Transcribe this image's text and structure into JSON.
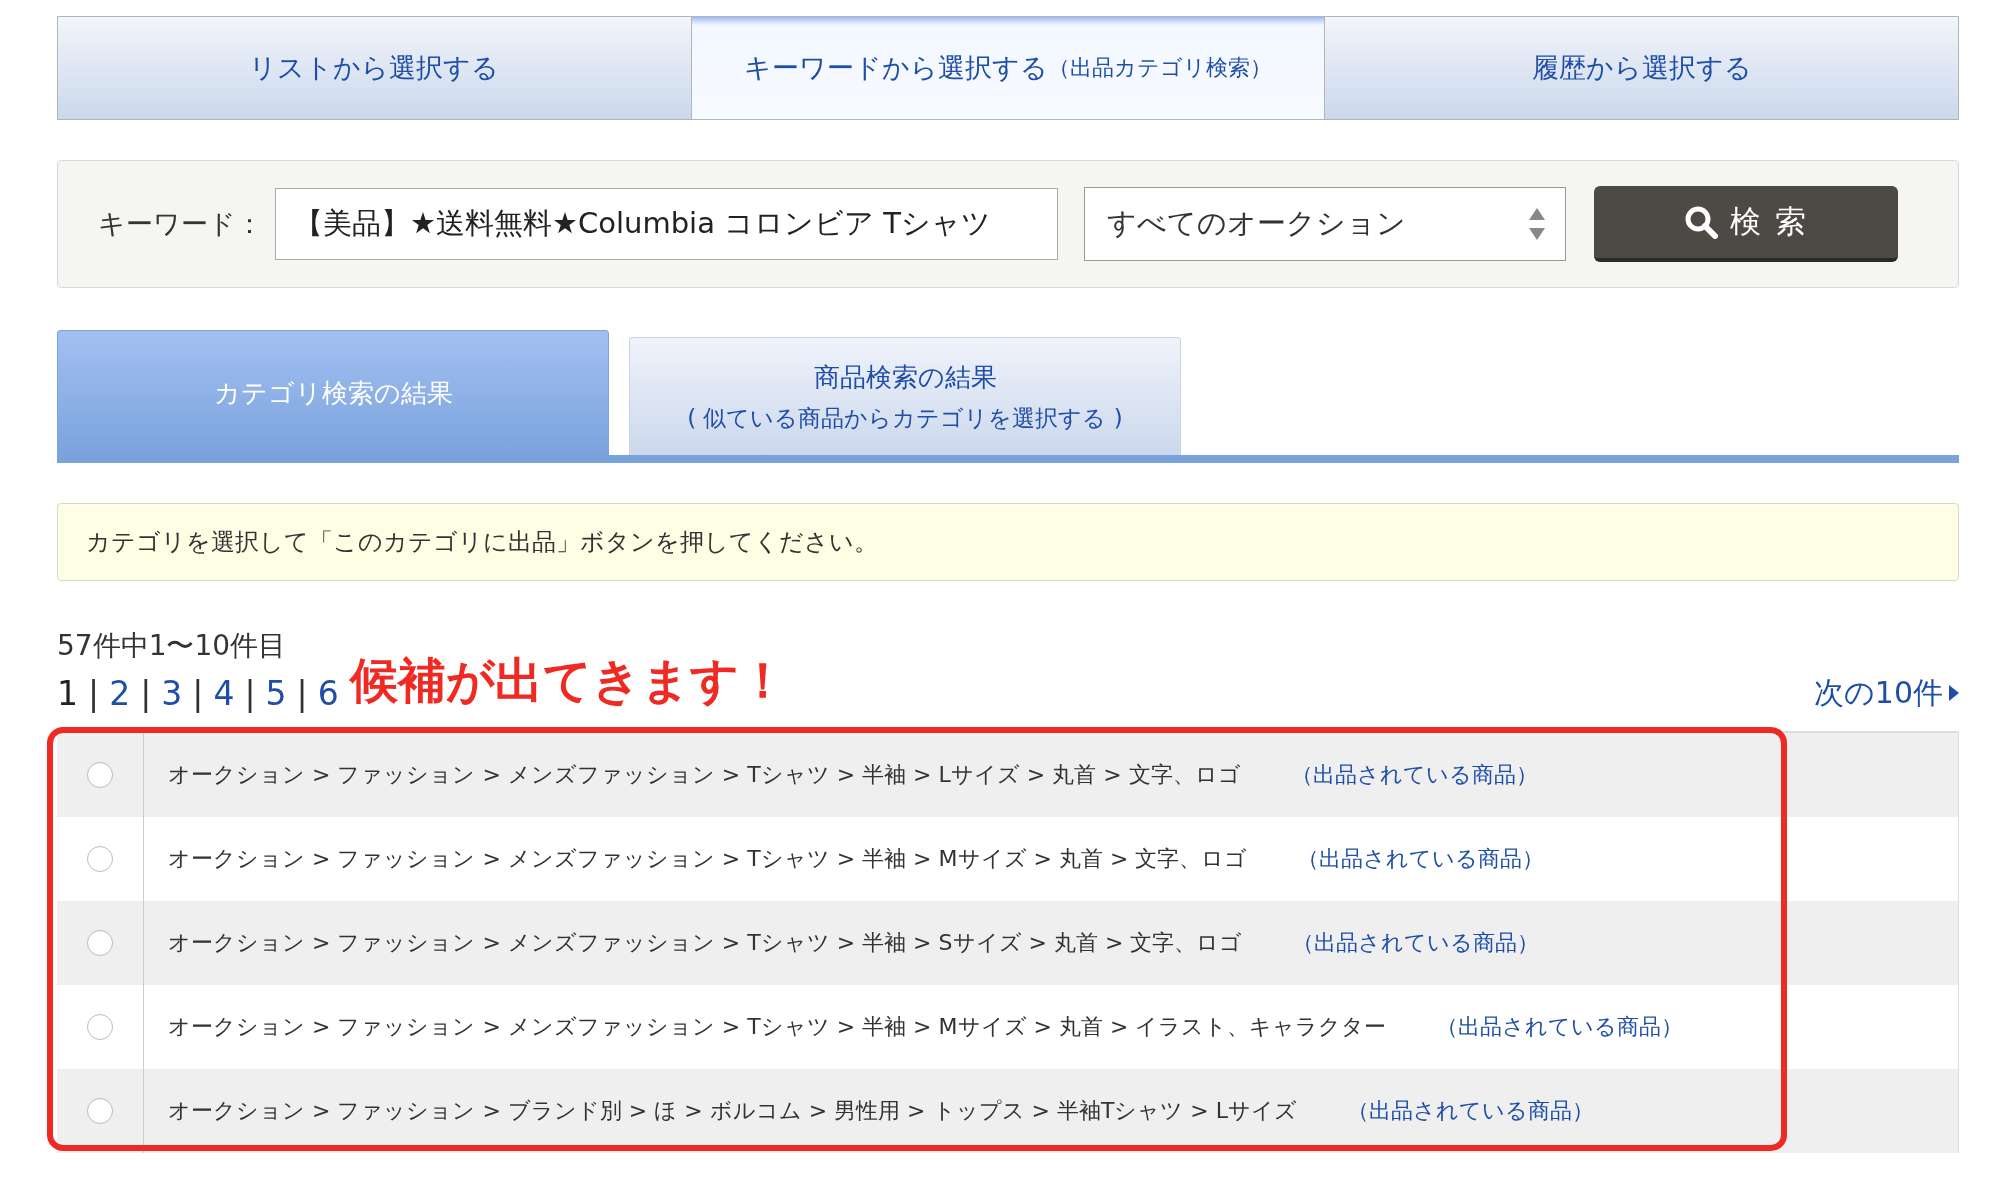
{
  "mode_tabs": [
    {
      "label": "リストから選択する",
      "selected": false
    },
    {
      "label": "キーワードから選択する",
      "note": "（出品カテゴリ検索）",
      "selected": true
    },
    {
      "label": "履歴から選択する",
      "selected": false
    }
  ],
  "search": {
    "label": "キーワード：",
    "value": "【美品】★送料無料★Columbia コロンビア Tシャツ",
    "scope": "すべてのオークション",
    "button": "検 索"
  },
  "result_tabs": [
    {
      "label": "カテゴリ検索の結果",
      "selected": true
    },
    {
      "label": "商品検索の結果",
      "sub": "( 似ている商品からカテゴリを選択する )",
      "selected": false
    }
  ],
  "notice": "カテゴリを選択して「このカテゴリに出品」ボタンを押してください。",
  "count": "57件中1〜10件目",
  "pages": [
    {
      "label": "1",
      "selected": true
    },
    {
      "separator": "|",
      "label": "2",
      "selected": false
    },
    {
      "separator": "|",
      "label": "3",
      "selected": false
    },
    {
      "separator": "|",
      "label": "4",
      "selected": false
    },
    {
      "separator": "|",
      "label": "5",
      "selected": false
    },
    {
      "separator": "|",
      "label": "6",
      "selected": false
    }
  ],
  "next": "次の10件",
  "annotation": "候補が出てきます！",
  "categories": [
    {
      "path": "オークション > ファッション > メンズファッション > Tシャツ > 半袖 > Lサイズ > 丸首 > 文字、ロゴ",
      "link": "（出品されている商品）",
      "selected": false
    },
    {
      "path": "オークション > ファッション > メンズファッション > Tシャツ > 半袖 > Mサイズ > 丸首 > 文字、ロゴ",
      "link": "（出品されている商品）",
      "selected": false
    },
    {
      "path": "オークション > ファッション > メンズファッション > Tシャツ > 半袖 > Sサイズ > 丸首 > 文字、ロゴ",
      "link": "（出品されている商品）",
      "selected": false
    },
    {
      "path": "オークション > ファッション > メンズファッション > Tシャツ > 半袖 > Mサイズ > 丸首 > イラスト、キャラクター",
      "link": "（出品されている商品）",
      "selected": false
    },
    {
      "path": "オークション > ファッション > ブランド別 > ほ > ボルコム > 男性用 > トップス > 半袖Tシャツ > Lサイズ",
      "link": "（出品されている商品）",
      "selected": false
    }
  ]
}
